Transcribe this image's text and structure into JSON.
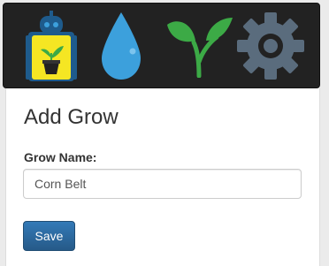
{
  "navbar": {
    "icons": [
      {
        "name": "robot-plant-icon"
      },
      {
        "name": "water-drop-icon"
      },
      {
        "name": "sprout-icon"
      },
      {
        "name": "gear-icon"
      }
    ]
  },
  "form": {
    "title": "Add Grow",
    "grow_name_label": "Grow Name:",
    "grow_name_value": "Corn Belt",
    "save_label": "Save"
  },
  "colors": {
    "navbar_bg": "#222222",
    "robot_yellow": "#f5e623",
    "robot_blue": "#1e5b8c",
    "water_blue": "#3ca0dc",
    "leaf_green": "#3caa46",
    "gear_gray": "#5a6c7d",
    "button_blue": "#2e6da4"
  }
}
